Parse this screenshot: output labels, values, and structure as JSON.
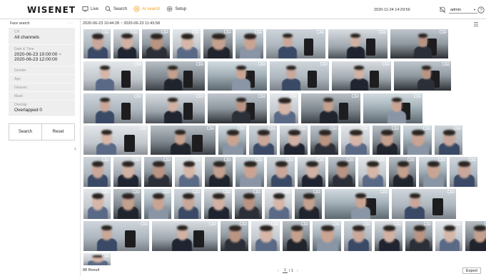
{
  "header": {
    "logo": "WISENET",
    "nav": [
      {
        "label": "Live",
        "icon": "monitor-icon",
        "active": false
      },
      {
        "label": "Search",
        "icon": "search-icon",
        "active": false
      },
      {
        "label": "AI search",
        "icon": "ai-search-icon",
        "active": true
      },
      {
        "label": "Setup",
        "icon": "gear-icon",
        "active": false
      }
    ],
    "datetime": "2020-11-24 14:29:56",
    "user": "admin",
    "accent_color": "#f0a020"
  },
  "sidebar": {
    "title": "Face search",
    "more_label": "···",
    "fields": [
      {
        "label": "CH",
        "value": "All channels"
      },
      {
        "label": "Date & Time",
        "value": "2020-06-23 10:00:00 ~ 2020-06-23 12:00:00"
      },
      {
        "label": "Gender",
        "value": ""
      },
      {
        "label": "Age",
        "value": ""
      },
      {
        "label": "Glasses",
        "value": ""
      },
      {
        "label": "Mask",
        "value": ""
      },
      {
        "label": "Overlap",
        "value": "Overlapped 0"
      }
    ],
    "search_label": "Search",
    "reset_label": "Reset",
    "collapse_glyph": "‹"
  },
  "results": {
    "range": "2020-06-23 10:44:28 ~ 2020-06-23 11:43:58",
    "count_text": "88 Result",
    "page_current": "1",
    "page_total_text": "/ 1",
    "prev_glyph": "‹",
    "next_glyph": "›",
    "export_label": "Export"
  }
}
